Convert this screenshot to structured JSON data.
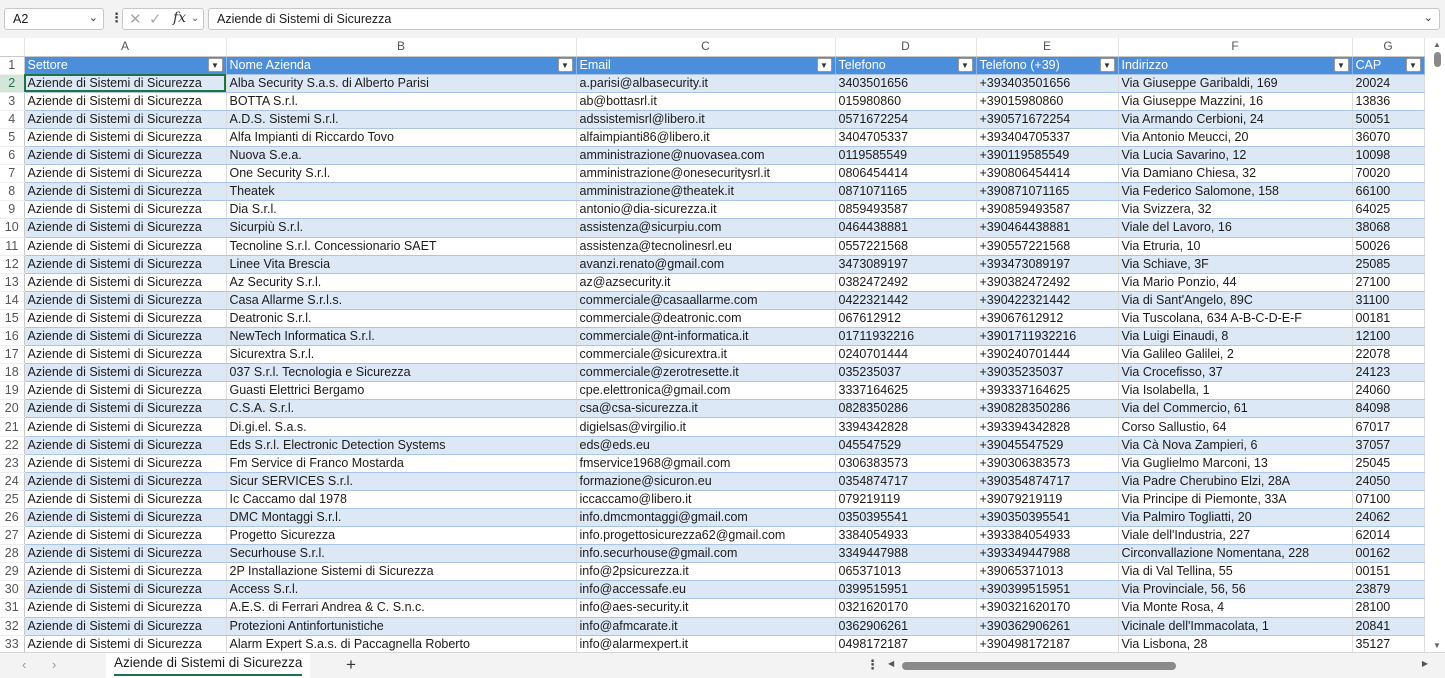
{
  "formula_bar": {
    "name_box": "A2",
    "formula": "Aziende di Sistemi di Sicurezza"
  },
  "columns": [
    "A",
    "B",
    "C",
    "D",
    "E",
    "F",
    "G"
  ],
  "headers": [
    "Settore",
    "Nome Azienda",
    "Email",
    "Telefono",
    "Telefono (+39)",
    "Indirizzo",
    "CAP"
  ],
  "rows": [
    [
      "Aziende di Sistemi di Sicurezza",
      "Alba Security S.a.s. di Alberto Parisi",
      "a.parisi@albasecurity.it",
      "3403501656",
      "+393403501656",
      "Via Giuseppe Garibaldi, 169",
      "20024"
    ],
    [
      "Aziende di Sistemi di Sicurezza",
      "BOTTA S.r.l.",
      "ab@bottasrl.it",
      "015980860",
      "+39015980860",
      "Via Giuseppe Mazzini, 16",
      "13836"
    ],
    [
      "Aziende di Sistemi di Sicurezza",
      "A.D.S. Sistemi S.r.l.",
      "adssistemisrl@libero.it",
      "0571672254",
      "+390571672254",
      "Via Armando Cerbioni, 24",
      "50051"
    ],
    [
      "Aziende di Sistemi di Sicurezza",
      "Alfa Impianti di Riccardo Tovo",
      "alfaimpianti86@libero.it",
      "3404705337",
      "+393404705337",
      "Via Antonio Meucci, 20",
      "36070"
    ],
    [
      "Aziende di Sistemi di Sicurezza",
      "Nuova S.e.a.",
      "amministrazione@nuovasea.com",
      "0119585549",
      "+390119585549",
      "Via Lucia Savarino, 12",
      "10098"
    ],
    [
      "Aziende di Sistemi di Sicurezza",
      "One Security S.r.l.",
      "amministrazione@onesecuritysrl.it",
      "0806454414",
      "+390806454414",
      "Via Damiano Chiesa, 32",
      "70020"
    ],
    [
      "Aziende di Sistemi di Sicurezza",
      "Theatek",
      "amministrazione@theatek.it",
      "0871071165",
      "+390871071165",
      "Via Federico Salomone, 158",
      "66100"
    ],
    [
      "Aziende di Sistemi di Sicurezza",
      "Dia S.r.l.",
      "antonio@dia-sicurezza.it",
      "0859493587",
      "+390859493587",
      "Via Svizzera, 32",
      "64025"
    ],
    [
      "Aziende di Sistemi di Sicurezza",
      "Sicurpiù S.r.l.",
      "assistenza@sicurpiu.com",
      "0464438881",
      "+390464438881",
      "Viale del Lavoro, 16",
      "38068"
    ],
    [
      "Aziende di Sistemi di Sicurezza",
      "Tecnoline S.r.l. Concessionario SAET",
      "assistenza@tecnolinesrl.eu",
      "0557221568",
      "+390557221568",
      "Via Etruria, 10",
      "50026"
    ],
    [
      "Aziende di Sistemi di Sicurezza",
      "Linee Vita Brescia",
      "avanzi.renato@gmail.com",
      "3473089197",
      "+393473089197",
      "Via Schiave, 3F",
      "25085"
    ],
    [
      "Aziende di Sistemi di Sicurezza",
      "Az Security S.r.l.",
      "az@azsecurity.it",
      "0382472492",
      "+390382472492",
      "Via Mario Ponzio, 44",
      "27100"
    ],
    [
      "Aziende di Sistemi di Sicurezza",
      "Casa Allarme S.r.l.s.",
      "commerciale@casaallarme.com",
      "0422321442",
      "+390422321442",
      "Via di Sant'Angelo, 89C",
      "31100"
    ],
    [
      "Aziende di Sistemi di Sicurezza",
      "Deatronic S.r.l.",
      "commerciale@deatronic.com",
      "067612912",
      "+39067612912",
      "Via Tuscolana, 634 A-B-C-D-E-F",
      "00181"
    ],
    [
      "Aziende di Sistemi di Sicurezza",
      "NewTech Informatica S.r.l.",
      "commerciale@nt-informatica.it",
      "01711932216",
      "+3901711932216",
      "Via Luigi Einaudi, 8",
      "12100"
    ],
    [
      "Aziende di Sistemi di Sicurezza",
      "Sicurextra S.r.l.",
      "commerciale@sicurextra.it",
      "0240701444",
      "+390240701444",
      "Via Galileo Galilei, 2",
      "22078"
    ],
    [
      "Aziende di Sistemi di Sicurezza",
      "037 S.r.l. Tecnologia e Sicurezza",
      "commerciale@zerotresette.it",
      "035235037",
      "+39035235037",
      "Via Crocefisso, 37",
      "24123"
    ],
    [
      "Aziende di Sistemi di Sicurezza",
      "Guasti Elettrici Bergamo",
      "cpe.elettronica@gmail.com",
      "3337164625",
      "+393337164625",
      "Via Isolabella, 1",
      "24060"
    ],
    [
      "Aziende di Sistemi di Sicurezza",
      "C.S.A. S.r.l.",
      "csa@csa-sicurezza.it",
      "0828350286",
      "+390828350286",
      "Via del Commercio, 61",
      "84098"
    ],
    [
      "Aziende di Sistemi di Sicurezza",
      "Di.gi.el. S.a.s.",
      "digielsas@virgilio.it",
      "3394342828",
      "+393394342828",
      "Corso Sallustio, 64",
      "67017"
    ],
    [
      "Aziende di Sistemi di Sicurezza",
      "Eds S.r.l. Electronic Detection Systems",
      "eds@eds.eu",
      "045547529",
      "+39045547529",
      "Via Cà Nova Zampieri, 6",
      "37057"
    ],
    [
      "Aziende di Sistemi di Sicurezza",
      "Fm Service di Franco Mostarda",
      "fmservice1968@gmail.com",
      "0306383573",
      "+390306383573",
      "Via Guglielmo Marconi, 13",
      "25045"
    ],
    [
      "Aziende di Sistemi di Sicurezza",
      "Sicur SERVICES S.r.l.",
      "formazione@sicuron.eu",
      "0354874717",
      "+390354874717",
      "Via Padre Cherubino Elzi, 28A",
      "24050"
    ],
    [
      "Aziende di Sistemi di Sicurezza",
      "Ic Caccamo dal 1978",
      "iccaccamo@libero.it",
      "079219119",
      "+39079219119",
      "Via Principe di Piemonte, 33A",
      "07100"
    ],
    [
      "Aziende di Sistemi di Sicurezza",
      "DMC Montaggi S.r.l.",
      "info.dmcmontaggi@gmail.com",
      "0350395541",
      "+390350395541",
      "Via Palmiro Togliatti, 20",
      "24062"
    ],
    [
      "Aziende di Sistemi di Sicurezza",
      "Progetto Sicurezza",
      "info.progettosicurezza62@gmail.com",
      "3384054933",
      "+393384054933",
      "Viale dell'Industria, 227",
      "62014"
    ],
    [
      "Aziende di Sistemi di Sicurezza",
      "Securhouse S.r.l.",
      "info.securhouse@gmail.com",
      "3349447988",
      "+393349447988",
      "Circonvallazione Nomentana, 228",
      "00162"
    ],
    [
      "Aziende di Sistemi di Sicurezza",
      "2P Installazione Sistemi di Sicurezza",
      "info@2psicurezza.it",
      "065371013",
      "+39065371013",
      "Via di Val Tellina, 55",
      "00151"
    ],
    [
      "Aziende di Sistemi di Sicurezza",
      "Access S.r.l.",
      "info@accessafe.eu",
      "0399515951",
      "+390399515951",
      "Via Provinciale, 56, 56",
      "23879"
    ],
    [
      "Aziende di Sistemi di Sicurezza",
      "A.E.S. di Ferrari Andrea & C. S.n.c.",
      "info@aes-security.it",
      "0321620170",
      "+390321620170",
      "Via Monte Rosa, 4",
      "28100"
    ],
    [
      "Aziende di Sistemi di Sicurezza",
      "Protezioni Antinfortunistiche",
      "info@afmcarate.it",
      "0362906261",
      "+390362906261",
      "Vicinale dell'Immacolata, 1",
      "20841"
    ],
    [
      "Aziende di Sistemi di Sicurezza",
      "Alarm Expert S.a.s. di Paccagnella Roberto",
      "info@alarmexpert.it",
      "0498172187",
      "+390498172187",
      "Via Lisbona, 28",
      "35127"
    ]
  ],
  "sheet_tabs": {
    "active": "Aziende di Sistemi di Sicurezza"
  },
  "icons": {
    "name_box_dropdown": "chevron-down-icon",
    "cancel": "close-icon",
    "confirm": "checkmark-icon",
    "function": "fx-icon",
    "filter": "filter-dropdown-icon",
    "add_sheet": "plus-icon"
  },
  "colors": {
    "header_fill": "#4b8edb",
    "band_fill": "#dce8f6",
    "accent": "#1f7244"
  }
}
